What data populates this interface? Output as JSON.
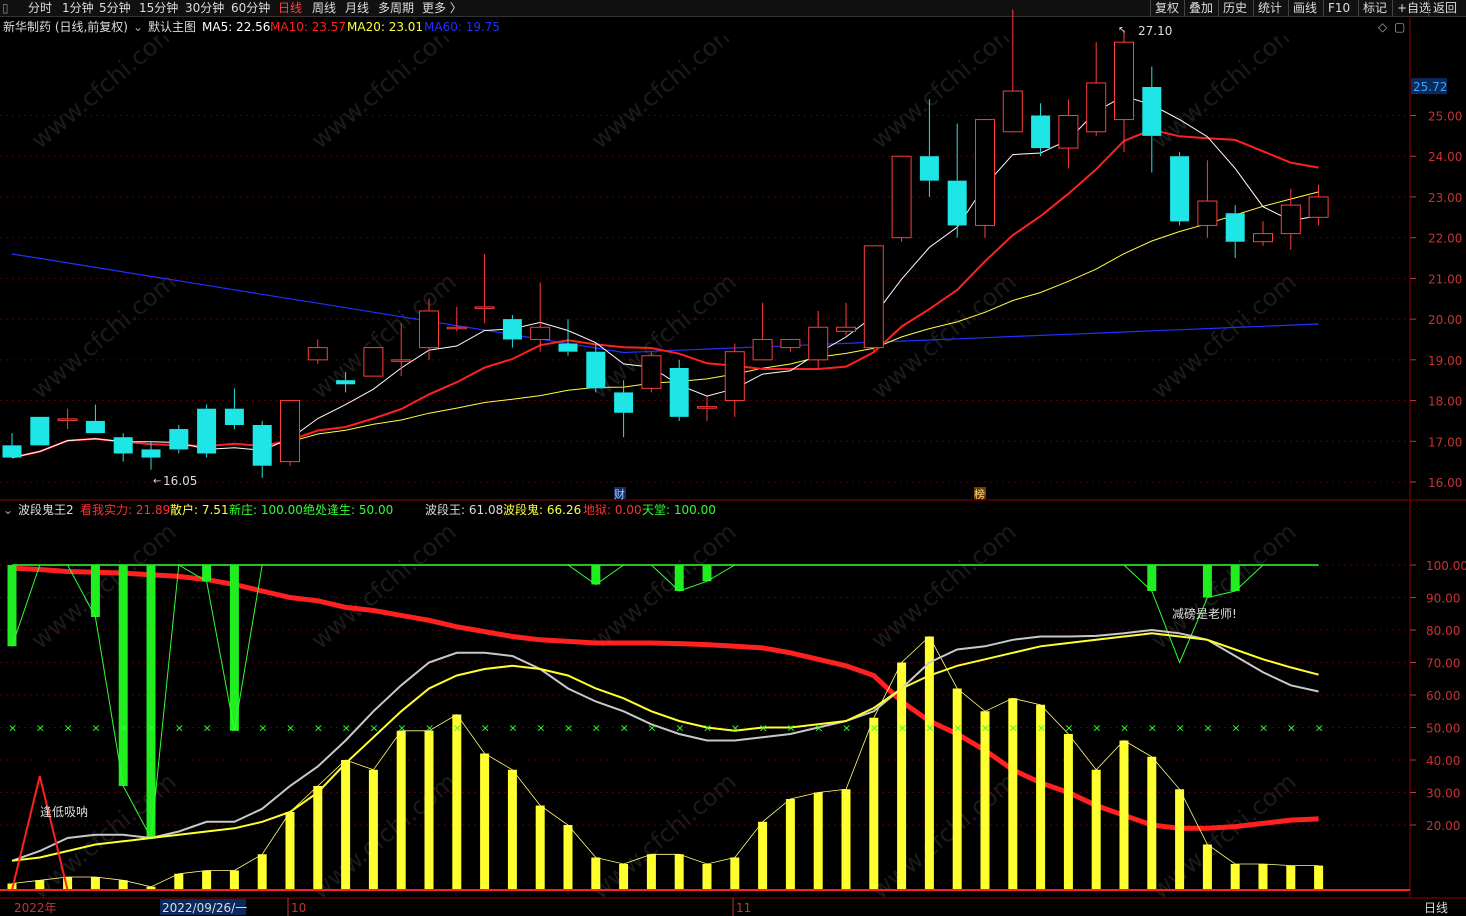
{
  "toolbar": {
    "periods": [
      "分时",
      "1分钟",
      "5分钟",
      "15分钟",
      "30分钟",
      "60分钟",
      "日线",
      "周线",
      "月线",
      "多周期",
      "更多 〉"
    ],
    "active_period": "日线",
    "right_buttons": [
      "复权",
      "叠加",
      "历史",
      "统计",
      "画线",
      "F10",
      "标记",
      "+自选",
      "返回"
    ]
  },
  "main_panel": {
    "title": "新华制药 (日线,前复权)",
    "template_label": "默认主图",
    "ma5": {
      "label": "MA5: 22.56",
      "color": "#ffffff"
    },
    "ma10": {
      "label": "MA10: 23.57",
      "color": "#ff2020"
    },
    "ma20": {
      "label": "MA20: 23.01",
      "color": "#ffff40"
    },
    "ma60": {
      "label": "MA60: 19.75",
      "color": "#2030ff"
    },
    "high_label": "27.10",
    "low_label": "16.05",
    "current_price": "25.72",
    "price_ticks": [
      "25.00",
      "24.00",
      "23.00",
      "22.00",
      "21.00",
      "20.00",
      "19.00",
      "18.00",
      "17.00",
      "16.00"
    ],
    "markers": [
      "财",
      "榜"
    ]
  },
  "indicator_panel": {
    "name": "波段鬼王2",
    "items": [
      {
        "label": "看我实力: 21.89",
        "color": "#ff3030"
      },
      {
        "label": "散户: 7.51",
        "color": "#ffff40"
      },
      {
        "label": "新庄: 100.00",
        "color": "#30ff30"
      },
      {
        "label": "绝处逢生: 50.00",
        "color": "#30ff30"
      },
      {
        "label": "波段王: 61.08",
        "color": "#dddddd"
      },
      {
        "label": "波段鬼: 66.26",
        "color": "#ffff40"
      },
      {
        "label": "地狱: 0.00",
        "color": "#ff3030"
      },
      {
        "label": "天堂: 100.00",
        "color": "#30ff30"
      }
    ],
    "ticks": [
      "100.00",
      "90.00",
      "80.00",
      "70.00",
      "60.00",
      "50.00",
      "40.00",
      "30.00",
      "20.00"
    ],
    "annotations": [
      "逢低吸呐",
      "减磅是老师!"
    ]
  },
  "xaxis": {
    "labels": [
      "2022年",
      "2022/09/26/一",
      "10",
      "11"
    ],
    "period_label": "日线"
  },
  "chart_data": {
    "type": "candlestick",
    "title": "新华制药 (日线,前复权)",
    "candles_ohlc": [
      [
        16.9,
        16.6,
        17.2,
        16.6
      ],
      [
        17.6,
        16.9,
        17.6,
        16.9
      ],
      [
        17.55,
        17.55,
        17.8,
        17.3
      ],
      [
        17.5,
        17.2,
        17.9,
        17.2
      ],
      [
        17.1,
        16.7,
        17.2,
        16.5
      ],
      [
        16.8,
        16.6,
        17.0,
        16.3
      ],
      [
        17.3,
        16.8,
        17.4,
        16.7
      ],
      [
        17.8,
        16.7,
        17.9,
        16.6
      ],
      [
        17.8,
        17.4,
        18.3,
        17.3
      ],
      [
        17.4,
        16.4,
        17.5,
        16.1
      ],
      [
        16.5,
        18.0,
        18.0,
        16.4
      ],
      [
        19.0,
        19.3,
        19.5,
        18.9
      ],
      [
        18.5,
        18.4,
        18.7,
        18.2
      ],
      [
        18.6,
        19.3,
        19.3,
        18.6
      ],
      [
        19.0,
        19.0,
        19.9,
        18.6
      ],
      [
        19.3,
        20.2,
        20.5,
        19.0
      ],
      [
        19.8,
        19.8,
        20.3,
        19.7
      ],
      [
        20.3,
        20.3,
        21.6,
        19.9
      ],
      [
        20.0,
        19.5,
        20.1,
        19.3
      ],
      [
        19.5,
        19.8,
        20.9,
        19.2
      ],
      [
        19.4,
        19.2,
        20.0,
        19.1
      ],
      [
        19.2,
        18.3,
        19.4,
        18.2
      ],
      [
        18.2,
        17.7,
        18.5,
        17.1
      ],
      [
        18.3,
        19.1,
        19.2,
        18.2
      ],
      [
        18.8,
        17.6,
        19.0,
        17.5
      ],
      [
        17.85,
        17.85,
        18.1,
        17.5
      ],
      [
        18.0,
        19.2,
        19.4,
        17.6
      ],
      [
        19.0,
        19.5,
        20.4,
        19.0
      ],
      [
        19.3,
        19.5,
        19.5,
        19.2
      ],
      [
        19.0,
        19.8,
        20.2,
        18.8
      ],
      [
        19.7,
        19.8,
        20.4,
        19.6
      ],
      [
        19.3,
        21.8,
        21.8,
        19.2
      ],
      [
        22.0,
        24.0,
        24.0,
        21.9
      ],
      [
        24.0,
        23.4,
        25.4,
        23.0
      ],
      [
        23.4,
        22.3,
        24.8,
        22.0
      ],
      [
        22.3,
        24.9,
        24.9,
        22.0
      ],
      [
        24.6,
        25.6,
        27.6,
        24.6
      ],
      [
        25.0,
        24.2,
        25.3,
        24.0
      ],
      [
        24.2,
        25.0,
        25.4,
        23.7
      ],
      [
        24.6,
        25.8,
        26.8,
        24.5
      ],
      [
        24.9,
        26.8,
        27.1,
        24.1
      ],
      [
        25.7,
        24.5,
        26.2,
        23.6
      ],
      [
        24.0,
        22.4,
        24.1,
        22.3
      ],
      [
        22.3,
        22.9,
        23.9,
        22.0
      ],
      [
        22.6,
        21.9,
        22.8,
        21.5
      ],
      [
        21.9,
        22.1,
        22.4,
        21.8
      ],
      [
        22.1,
        22.8,
        23.2,
        21.7
      ],
      [
        22.5,
        23.0,
        23.3,
        22.3
      ]
    ],
    "ma5_note": "white line",
    "ma10_note": "red line",
    "ma20_note": "yellow line",
    "ma60_note": "blue line",
    "ylim_main": [
      16.0,
      25.7
    ],
    "indicator_ylim": [
      0,
      100
    ]
  }
}
